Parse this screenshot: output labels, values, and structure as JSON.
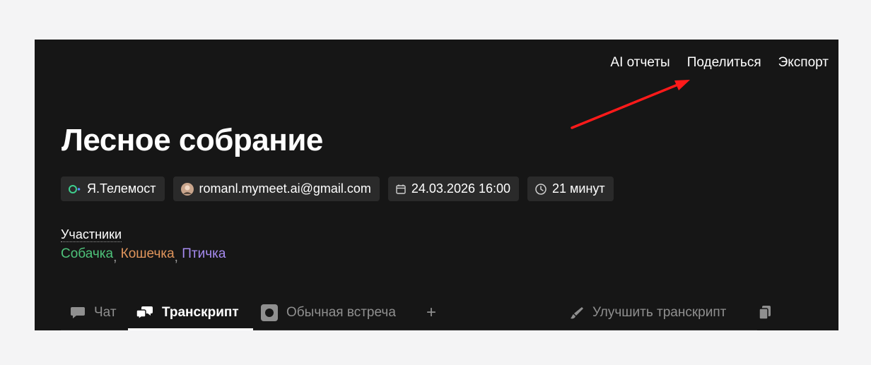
{
  "topnav": {
    "ai_reports": "AI отчеты",
    "share": "Поделиться",
    "export": "Экспорт"
  },
  "meeting": {
    "title": "Лесное собрание",
    "platform": "Я.Телемост",
    "email": "romanl.mymeet.ai@gmail.com",
    "datetime": "24.03.2026 16:00",
    "duration": "21 минут"
  },
  "participants": {
    "label": "Участники",
    "names": [
      "Собачка",
      "Кошечка",
      "Птичка"
    ],
    "separator": ",",
    "colors": [
      "#4ec27a",
      "#e0955c",
      "#a68bf0"
    ]
  },
  "tabs": {
    "chat": "Чат",
    "transcript": "Транскрипт",
    "meeting_type": "Обычная встреча",
    "add": "+",
    "improve": "Улучшить транскрипт",
    "active": "transcript"
  },
  "annotation": {
    "arrow_color": "#ff1a1a",
    "points_to": "share"
  }
}
